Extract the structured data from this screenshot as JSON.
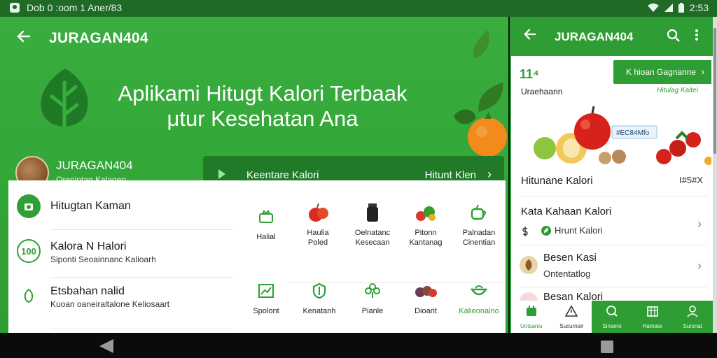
{
  "status_bar": {
    "left_text": "Dob 0 :oom  1 Aner/83",
    "time": "2:53"
  },
  "main": {
    "title": "JURAGAN404",
    "hero": {
      "line1": "Aplikami Hitugt Kalori Terbaak",
      "line2": "μtur Kesehatan Ana"
    },
    "profile": {
      "name": "JURAGAN404",
      "subtitle": "Orenintag Kalagen"
    },
    "calc_bar": {
      "label": "Keentare Kalori",
      "action": "Hitunt Klen"
    },
    "list": [
      {
        "title": "Hitugtan Kaman",
        "subtitle": "",
        "icon": "scale-icon"
      },
      {
        "title": "Kalora N Halori",
        "subtitle": "Siponti Seoainnanc Kalioarh",
        "icon": "100-badge-icon"
      },
      {
        "title": "Etsbahan nalid",
        "subtitle": "Kuoan oaneiraltalone Keliosaart",
        "icon": "leaf-icon"
      }
    ],
    "grid": [
      {
        "label": "Halial",
        "icon": "tray-icon"
      },
      {
        "label": "Haulia\nPoled",
        "icon": "apple-icon"
      },
      {
        "label": "Oelnatanc\nKesecaan",
        "icon": "jar-icon"
      },
      {
        "label": "Pitonn\nKantanag",
        "icon": "vegetables-icon"
      },
      {
        "label": "Palnadan\nCinentian",
        "icon": "cup-icon"
      },
      {
        "label": "Spolont",
        "icon": "chart-icon"
      },
      {
        "label": "Kenatanh",
        "icon": "shield-icon"
      },
      {
        "label": "Pianle",
        "icon": "clover-icon"
      },
      {
        "label": "Dioarit",
        "icon": "berries-icon"
      },
      {
        "label": "Kalieonalno",
        "icon": "bowl-icon"
      }
    ]
  },
  "side": {
    "title": "JURAGAN404",
    "count": "11⁴",
    "category": "Uraehaann",
    "chip_label": "K hioan Gagnanne",
    "chip_link": "Hitulag Kaltei",
    "fruit_label": "#EC84Mfo",
    "section_title": "Hitunane Kalori",
    "section_badge": "I#5#X",
    "rows": [
      {
        "title": "Kata Kahaan Kalori",
        "sub": "Hrunt Kalori",
        "icon": ""
      },
      {
        "title": "Besen Kasi",
        "sub": "Ontentatlog",
        "icon": "leaf-avatar"
      },
      {
        "title": "Besan Kalori",
        "sub": "",
        "icon": "apple-avatar"
      }
    ],
    "nav": [
      {
        "label": "Uotsaniu",
        "icon": "calendar-icon",
        "style": "light"
      },
      {
        "label": "Sucurnair",
        "icon": "warning-icon",
        "style": "light"
      },
      {
        "label": "Sinamo",
        "icon": "search-icon",
        "style": "dark"
      },
      {
        "label": "Hamate",
        "icon": "grid-icon",
        "style": "dark"
      },
      {
        "label": "Sursnat",
        "icon": "profile-icon",
        "style": "dark"
      }
    ]
  },
  "colors": {
    "primary": "#2e9e34",
    "dark_green": "#217a28",
    "status_bar": "#1f6a25"
  }
}
